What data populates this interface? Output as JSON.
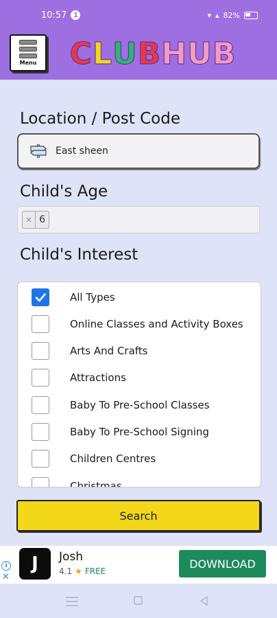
{
  "status_bar": {
    "time": "10:57",
    "notification_count": "1",
    "battery_percent": "82%"
  },
  "header": {
    "menu_label": "Menu",
    "logo_letters": [
      {
        "ch": "C",
        "color": "#e8384f"
      },
      {
        "ch": "L",
        "color": "#f2d71b"
      },
      {
        "ch": "U",
        "color": "#2bb673"
      },
      {
        "ch": "B",
        "color": "#e8384f"
      },
      {
        "ch": " ",
        "color": "#ffffff"
      },
      {
        "ch": "H",
        "color": "#f39ac3"
      },
      {
        "ch": "U",
        "color": "#f39ac3"
      },
      {
        "ch": "B",
        "color": "#f39ac3"
      }
    ]
  },
  "location": {
    "label": "Location / Post Code",
    "value": "East sheen",
    "icon": "signpost-icon"
  },
  "age": {
    "label": "Child's Age",
    "chip_remove": "×",
    "chip_value": "6"
  },
  "interest": {
    "label": "Child's Interest",
    "items": [
      {
        "label": "All Types",
        "checked": true
      },
      {
        "label": "Online Classes and Activity Boxes",
        "checked": false
      },
      {
        "label": "Arts And Crafts",
        "checked": false
      },
      {
        "label": "Attractions",
        "checked": false
      },
      {
        "label": "Baby To Pre-School Classes",
        "checked": false
      },
      {
        "label": "Baby To Pre-School Signing",
        "checked": false
      },
      {
        "label": "Children Centres",
        "checked": false
      },
      {
        "label": "Christmas",
        "checked": false
      }
    ]
  },
  "search_button": "Search",
  "ad": {
    "app_name": "Josh",
    "rating": "4.1",
    "price": "FREE",
    "cta": "DOWNLOAD",
    "logo_glyph": "J"
  },
  "colors": {
    "header_bg": "#9d6fe0",
    "page_bg": "#dfe3f7",
    "search_bg": "#f2d71b",
    "checkbox_checked": "#1f74e6",
    "download_bg": "#1d8a5c"
  }
}
